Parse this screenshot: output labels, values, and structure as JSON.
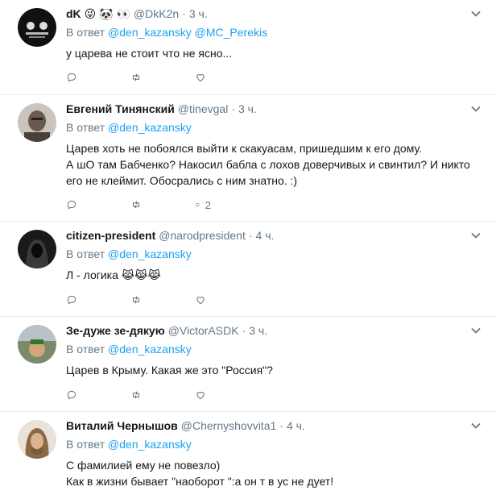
{
  "tweets": [
    {
      "name": "dK",
      "name_emojis": "😜 🐼 👀",
      "handle": "@DkK2n",
      "dot": "·",
      "time": "3 ч.",
      "reply_prefix": "В ответ",
      "mentions": "@den_kazansky @MC_Perekis",
      "text": "у царева не стоит что не ясно...",
      "reply_count": "",
      "retweet_count": "",
      "like_count": ""
    },
    {
      "name": "Евгений Тинянский",
      "handle": "@tinevgal",
      "dot": "·",
      "time": "3 ч.",
      "reply_prefix": "В ответ",
      "mentions": "@den_kazansky",
      "text": "Царев хоть не побоялся выйти к скакуасам, пришедшим к его дому.\nА шО там Бабченко? Накосил бабла с лохов доверчивых и свинтил? И никто его не клеймит. Обосрались с ним знатно. :)",
      "reply_count": "",
      "retweet_count": "",
      "like_count": "2"
    },
    {
      "name": "citizen-president",
      "handle": "@narodpresident",
      "dot": "·",
      "time": "4 ч.",
      "reply_prefix": "В ответ",
      "mentions": "@den_kazansky",
      "text": "Л - логика 😹😹😹",
      "reply_count": "",
      "retweet_count": "",
      "like_count": ""
    },
    {
      "name": "Зе-дуже зе-дякую",
      "handle": "@VictorASDK",
      "dot": "·",
      "time": "3 ч.",
      "reply_prefix": "В ответ",
      "mentions": "@den_kazansky",
      "text": "Царев в Крыму. Какая же это \"Россия\"?",
      "reply_count": "",
      "retweet_count": "",
      "like_count": ""
    },
    {
      "name": "Виталий Чернышов",
      "handle": "@Chernyshovvita1",
      "dot": "·",
      "time": "4 ч.",
      "reply_prefix": "В ответ",
      "mentions": "@den_kazansky",
      "text": "С фамилией ему не повезло)\nКак в жизни бывает \"наоборот \":а он т в ус не дует!",
      "reply_count": "",
      "retweet_count": "",
      "like_count": ""
    }
  ],
  "colors": {
    "link": "#1da1f2",
    "secondary": "#657786",
    "divider": "#e6ecf0"
  },
  "icons": {
    "reply": "reply-icon",
    "retweet": "retweet-icon",
    "like": "heart-icon",
    "menu": "chevron-down-icon"
  }
}
